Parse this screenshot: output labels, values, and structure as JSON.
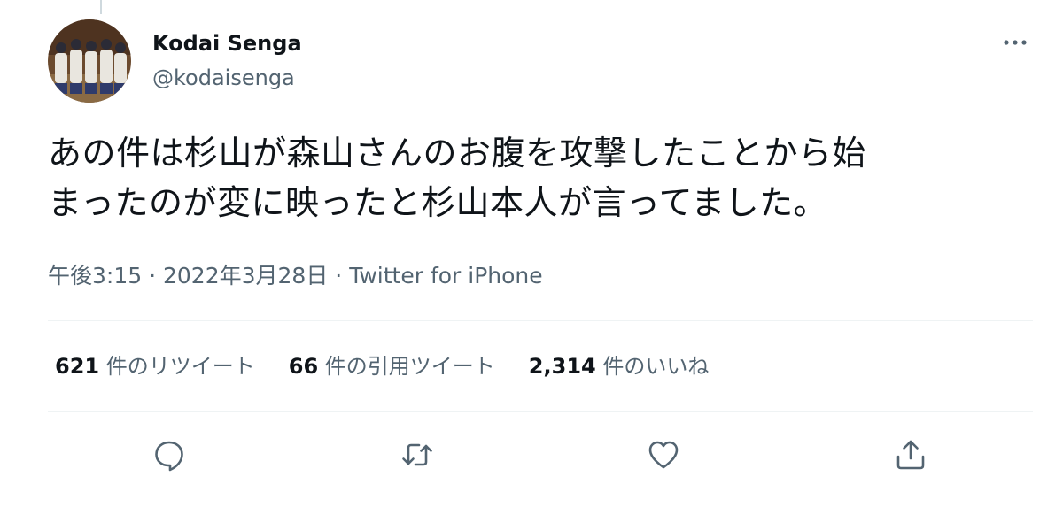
{
  "author": {
    "name": "Kodai Senga",
    "handle": "@kodaisenga"
  },
  "tweet": {
    "text_line1": "あの件は杉山が森山さんのお腹を攻撃したことから始",
    "text_line2": "まったのが変に映ったと杉山本人が言ってました。"
  },
  "meta": {
    "time": "午後3:15",
    "separator": "·",
    "date": "2022年3月28日",
    "source": "Twitter for iPhone"
  },
  "stats": {
    "retweets": {
      "num": "621",
      "label": "件のリツイート"
    },
    "quotes": {
      "num": "66",
      "label": "件の引用ツイート"
    },
    "likes": {
      "num": "2,314",
      "label": "件のいいね"
    }
  },
  "icons": {
    "more": "more-icon",
    "reply": "reply-icon",
    "retweet": "retweet-icon",
    "like": "like-icon",
    "share": "share-icon"
  },
  "colors": {
    "text_primary": "#0f1419",
    "text_secondary": "#536471",
    "divider": "#eff3f4"
  }
}
